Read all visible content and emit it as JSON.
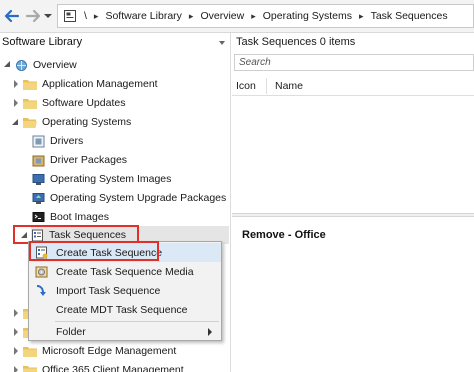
{
  "breadcrumb": {
    "root_sep": "\\",
    "items": [
      "Software Library",
      "Overview",
      "Operating Systems",
      "Task Sequences"
    ],
    "separator": "▸"
  },
  "left_pane": {
    "title": "Software Library",
    "tree": {
      "overview": "Overview",
      "application_management": "Application Management",
      "software_updates": "Software Updates",
      "operating_systems": "Operating Systems",
      "drivers": "Drivers",
      "driver_packages": "Driver Packages",
      "os_images": "Operating System Images",
      "os_upgrade_packages": "Operating System Upgrade Packages",
      "boot_images": "Boot Images",
      "task_sequences": "Task Sequences",
      "microsoft_edge_management": "Microsoft Edge Management",
      "office_365_client_management": "Office 365 Client Management"
    }
  },
  "context_menu": {
    "items": [
      {
        "label": "Create Task Sequence",
        "icon": "create-task-sequence-icon"
      },
      {
        "label": "Create Task Sequence Media",
        "icon": "create-media-icon"
      },
      {
        "label": "Import Task Sequence",
        "icon": "import-arrow-icon"
      },
      {
        "label": "Create MDT Task Sequence",
        "icon": "mdt-icon"
      }
    ],
    "folder": {
      "label": "Folder"
    }
  },
  "right_pane": {
    "title": "Task Sequences 0 items",
    "search_placeholder": "Search",
    "columns": [
      "Icon",
      "Name"
    ],
    "details_title": "Remove - Office"
  },
  "colors": {
    "highlight": "#e0302a",
    "folder": "#e8c15a",
    "accent_blue": "#2b6cc4"
  }
}
